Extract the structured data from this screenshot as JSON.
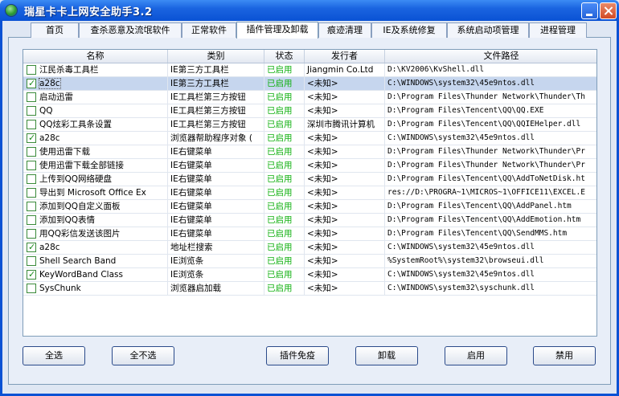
{
  "window": {
    "title": "瑞星卡卡上网安全助手3.2"
  },
  "tabs": [
    {
      "label": "首页"
    },
    {
      "label": "查杀恶意及流氓软件"
    },
    {
      "label": "正常软件"
    },
    {
      "label": "插件管理及卸载"
    },
    {
      "label": "痕迹清理"
    },
    {
      "label": "IE及系统修复"
    },
    {
      "label": "系统启动项管理"
    },
    {
      "label": "进程管理"
    }
  ],
  "active_tab": "插件管理及卸载",
  "table": {
    "columns": [
      "名称",
      "类别",
      "状态",
      "发行者",
      "文件路径"
    ],
    "rows": [
      {
        "checked": false,
        "name": "江民杀毒工具栏",
        "category": "IE第三方工具栏",
        "status": "已启用",
        "publisher": "Jiangmin Co.Ltd",
        "path": "D:\\KV2006\\KvShell.dll"
      },
      {
        "checked": true,
        "name": "a28c",
        "category": "IE第三方工具栏",
        "status": "已启用",
        "publisher": "<未知>",
        "path": "C:\\WINDOWS\\system32\\45e9ntos.dll",
        "selected": true
      },
      {
        "checked": false,
        "name": "启动迅雷",
        "category": "IE工具栏第三方按钮",
        "status": "已启用",
        "publisher": "<未知>",
        "path": "D:\\Program Files\\Thunder Network\\Thunder\\Th"
      },
      {
        "checked": false,
        "name": "QQ",
        "category": "IE工具栏第三方按钮",
        "status": "已启用",
        "publisher": "<未知>",
        "path": "D:\\Program Files\\Tencent\\QQ\\QQ.EXE"
      },
      {
        "checked": false,
        "name": "QQ炫彩工具条设置",
        "category": "IE工具栏第三方按钮",
        "status": "已启用",
        "publisher": "深圳市腾讯计算机",
        "path": "D:\\Program Files\\Tencent\\QQ\\QQIEHelper.dll"
      },
      {
        "checked": true,
        "name": "a28c",
        "category": "浏览器帮助程序对象 (",
        "status": "已启用",
        "publisher": "<未知>",
        "path": "C:\\WINDOWS\\system32\\45e9ntos.dll"
      },
      {
        "checked": false,
        "name": "使用迅雷下载",
        "category": "IE右键菜单",
        "status": "已启用",
        "publisher": "<未知>",
        "path": "D:\\Program Files\\Thunder Network\\Thunder\\Pr"
      },
      {
        "checked": false,
        "name": "使用迅雷下载全部链接",
        "category": "IE右键菜单",
        "status": "已启用",
        "publisher": "<未知>",
        "path": "D:\\Program Files\\Thunder Network\\Thunder\\Pr"
      },
      {
        "checked": false,
        "name": "上传到QQ网络硬盘",
        "category": "IE右键菜单",
        "status": "已启用",
        "publisher": "<未知>",
        "path": "D:\\Program Files\\Tencent\\QQ\\AddToNetDisk.ht"
      },
      {
        "checked": false,
        "name": "导出到 Microsoft Office Ex",
        "category": "IE右键菜单",
        "status": "已启用",
        "publisher": "<未知>",
        "path": "res://D:\\PROGRA~1\\MICROS~1\\OFFICE11\\EXCEL.E"
      },
      {
        "checked": false,
        "name": "添加到QQ自定义面板",
        "category": "IE右键菜单",
        "status": "已启用",
        "publisher": "<未知>",
        "path": "D:\\Program Files\\Tencent\\QQ\\AddPanel.htm"
      },
      {
        "checked": false,
        "name": "添加到QQ表情",
        "category": "IE右键菜单",
        "status": "已启用",
        "publisher": "<未知>",
        "path": "D:\\Program Files\\Tencent\\QQ\\AddEmotion.htm"
      },
      {
        "checked": false,
        "name": "用QQ彩信发送该图片",
        "category": "IE右键菜单",
        "status": "已启用",
        "publisher": "<未知>",
        "path": "D:\\Program Files\\Tencent\\QQ\\SendMMS.htm"
      },
      {
        "checked": true,
        "name": "a28c",
        "category": "地址栏搜索",
        "status": "已启用",
        "publisher": "<未知>",
        "path": "C:\\WINDOWS\\system32\\45e9ntos.dll"
      },
      {
        "checked": false,
        "name": "Shell Search Band",
        "category": "IE浏览条",
        "status": "已启用",
        "publisher": "<未知>",
        "path": "%SystemRoot%\\system32\\browseui.dll"
      },
      {
        "checked": true,
        "name": "KeyWordBand Class",
        "category": "IE浏览条",
        "status": "已启用",
        "publisher": "<未知>",
        "path": "C:\\WINDOWS\\system32\\45e9ntos.dll"
      },
      {
        "checked": false,
        "name": "SysChunk",
        "category": "浏览器启加载",
        "status": "已启用",
        "publisher": "<未知>",
        "path": "C:\\WINDOWS\\system32\\syschunk.dll"
      }
    ]
  },
  "buttons": {
    "select_all": "全选",
    "select_none": "全不选",
    "immunize": "插件免疫",
    "uninstall": "卸载",
    "enable": "启用",
    "disable": "禁用"
  },
  "colors": {
    "titlebar": "#0a52d4",
    "status_enabled": "#10b010",
    "selected_row": "#c6d6ee"
  }
}
